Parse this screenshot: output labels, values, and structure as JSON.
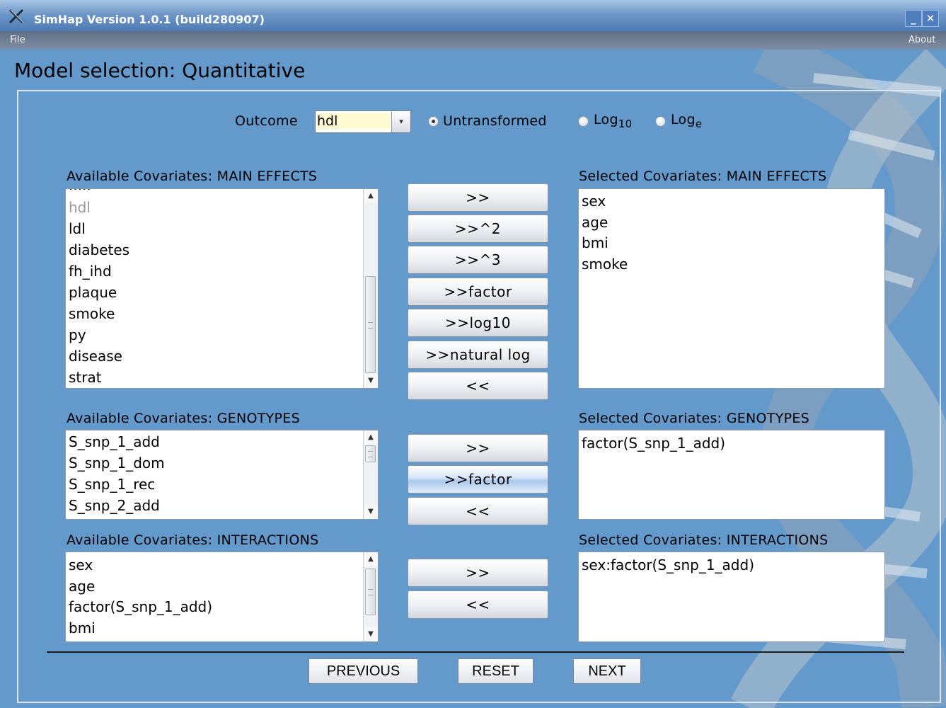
{
  "window": {
    "title": "SimHap Version 1.0.1 (build280907)",
    "minimize": "_",
    "close": "✕"
  },
  "menu": {
    "file": "File",
    "about": "About"
  },
  "page_title": "Model selection: Quantitative",
  "outcome": {
    "label": "Outcome",
    "value": "hdl",
    "transforms": {
      "untransformed": "Untransformed",
      "log10_base": "Log",
      "log10_sub": "10",
      "loge_base": "Log",
      "loge_sub": "e",
      "selected": "Untransformed"
    }
  },
  "main_effects": {
    "available_label": "Available Covariates: MAIN EFFECTS",
    "available_partial": "·····",
    "available": [
      "hdl",
      "ldl",
      "diabetes",
      "fh_ihd",
      "plaque",
      "smoke",
      "py",
      "disease",
      "strat"
    ],
    "disabled_item": "hdl",
    "selected_label": "Selected Covariates: MAIN EFFECTS",
    "selected": [
      "sex",
      "age",
      "bmi",
      "smoke"
    ],
    "buttons": [
      ">>",
      ">>^2",
      ">>^3",
      ">>factor",
      ">>log10",
      ">>natural log",
      "<<"
    ]
  },
  "genotypes": {
    "available_label": "Available Covariates: GENOTYPES",
    "available": [
      "S_snp_1_add",
      "S_snp_1_dom",
      "S_snp_1_rec",
      "S_snp_2_add"
    ],
    "selected_label": "Selected Covariates: GENOTYPES",
    "selected": [
      "factor(S_snp_1_add)"
    ],
    "buttons": [
      ">>",
      ">>factor",
      "<<"
    ]
  },
  "interactions": {
    "available_label": "Available Covariates: INTERACTIONS",
    "available": [
      "sex",
      "age",
      "factor(S_snp_1_add)",
      "bmi"
    ],
    "selected_label": "Selected Covariates: INTERACTIONS",
    "selected": [
      "sex:factor(S_snp_1_add)"
    ],
    "buttons": [
      ">>",
      "<<"
    ]
  },
  "nav": {
    "previous": "PREVIOUS",
    "reset": "RESET",
    "next": "NEXT"
  }
}
